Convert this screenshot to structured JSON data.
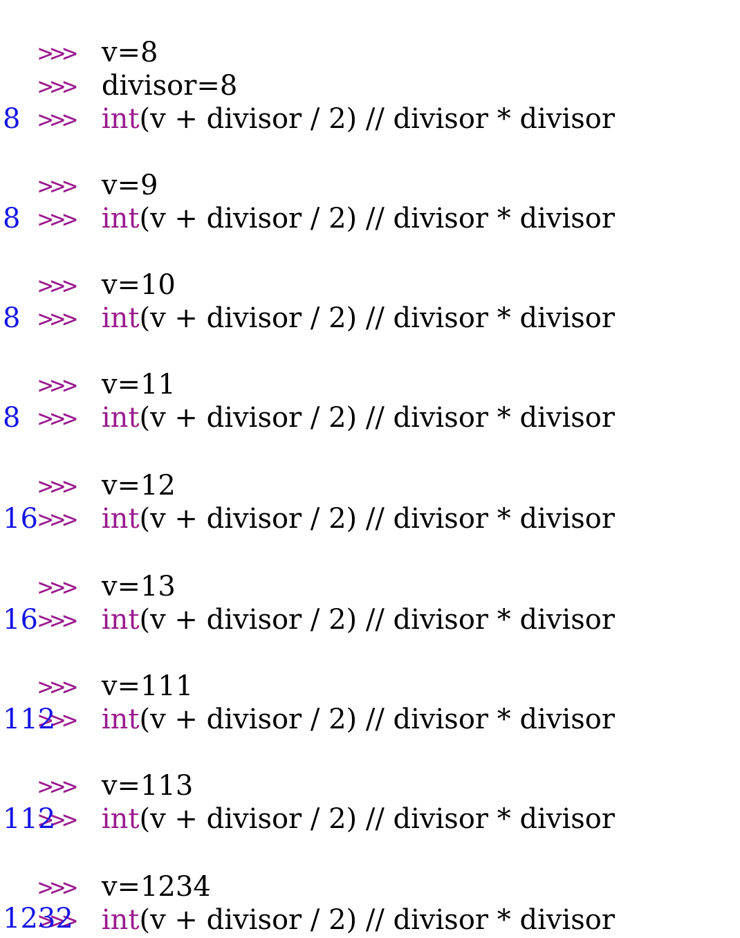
{
  "console": {
    "prompt": ">>>",
    "colors": {
      "prompt": "#9a1a8e",
      "keyword": "#9a1a8e",
      "code": "#000000",
      "output": "#1414e6",
      "background": "#ffffff"
    },
    "lines": [
      {
        "type": "input",
        "kw": "",
        "text": "v=8"
      },
      {
        "type": "input",
        "kw": "",
        "text": "divisor=8"
      },
      {
        "type": "input",
        "kw": "int",
        "text": "(v + divisor / 2) // divisor * divisor"
      },
      {
        "type": "output",
        "text": "8"
      },
      {
        "type": "input",
        "kw": "",
        "text": "v=9"
      },
      {
        "type": "input",
        "kw": "int",
        "text": "(v + divisor / 2) // divisor * divisor"
      },
      {
        "type": "output",
        "text": "8"
      },
      {
        "type": "input",
        "kw": "",
        "text": "v=10"
      },
      {
        "type": "input",
        "kw": "int",
        "text": "(v + divisor / 2) // divisor * divisor"
      },
      {
        "type": "output",
        "text": "8"
      },
      {
        "type": "input",
        "kw": "",
        "text": "v=11"
      },
      {
        "type": "input",
        "kw": "int",
        "text": "(v + divisor / 2) // divisor * divisor"
      },
      {
        "type": "output",
        "text": "8"
      },
      {
        "type": "input",
        "kw": "",
        "text": "v=12"
      },
      {
        "type": "input",
        "kw": "int",
        "text": "(v + divisor / 2) // divisor * divisor"
      },
      {
        "type": "output",
        "text": "16"
      },
      {
        "type": "input",
        "kw": "",
        "text": "v=13"
      },
      {
        "type": "input",
        "kw": "int",
        "text": "(v + divisor / 2) // divisor * divisor"
      },
      {
        "type": "output",
        "text": "16"
      },
      {
        "type": "input",
        "kw": "",
        "text": "v=111"
      },
      {
        "type": "input",
        "kw": "int",
        "text": "(v + divisor / 2) // divisor * divisor"
      },
      {
        "type": "output",
        "text": "112"
      },
      {
        "type": "input",
        "kw": "",
        "text": "v=113"
      },
      {
        "type": "input",
        "kw": "int",
        "text": "(v + divisor / 2) // divisor * divisor"
      },
      {
        "type": "output",
        "text": "112"
      },
      {
        "type": "input",
        "kw": "",
        "text": "v=1234"
      },
      {
        "type": "input",
        "kw": "int",
        "text": "(v + divisor / 2) // divisor * divisor"
      },
      {
        "type": "output",
        "text": "1232"
      }
    ]
  }
}
